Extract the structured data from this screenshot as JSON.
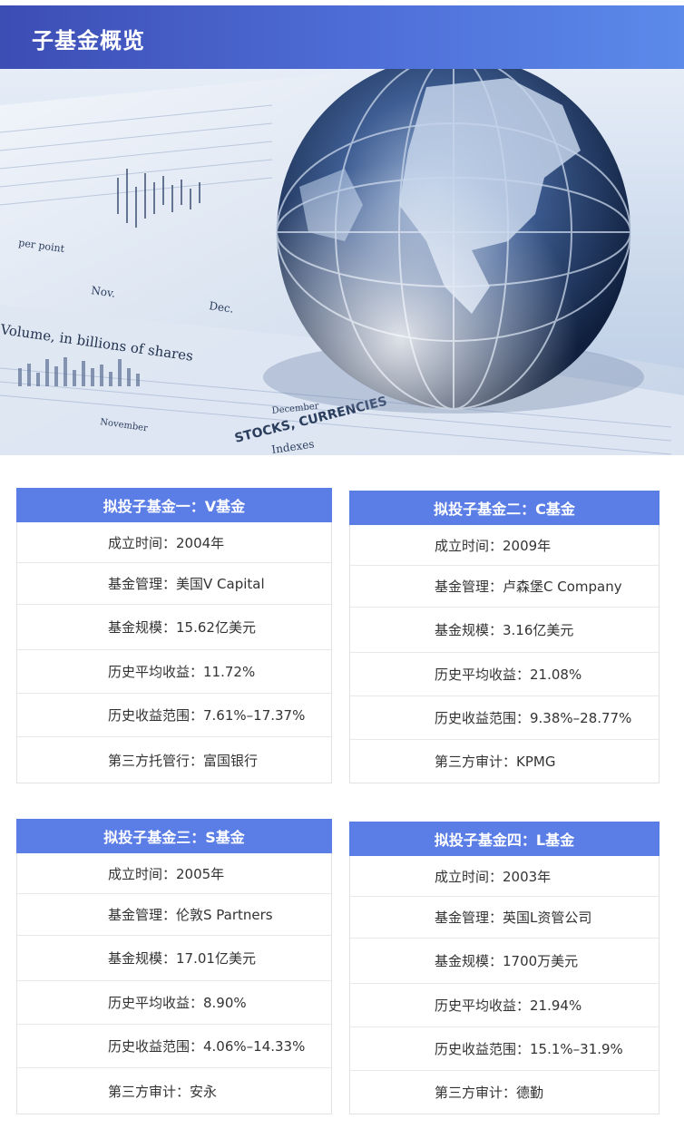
{
  "header": {
    "title": "子基金概览"
  },
  "hero": {
    "volume_text": "Volume, in billions of shares",
    "nov": "Nov.",
    "dec": "Dec.",
    "stocks_text": "STOCKS, CURRENCIES",
    "indexes_text": "Indexes",
    "november": "November",
    "december": "December",
    "point_text": "per point"
  },
  "funds": [
    {
      "title": "拟投子基金一：V基金",
      "rows": [
        "成立时间：2004年",
        "基金管理：美国V Capital",
        "基金规模：15.62亿美元",
        "历史平均收益：11.72%",
        "历史收益范围：7.61%–17.37%",
        "第三方托管行：富国银行"
      ]
    },
    {
      "title": "拟投子基金二：C基金",
      "rows": [
        "成立时间：2009年",
        "基金管理：卢森堡C Company",
        "基金规模：3.16亿美元",
        "历史平均收益：21.08%",
        "历史收益范围：9.38%–28.77%",
        "第三方审计：KPMG"
      ]
    },
    {
      "title": "拟投子基金三：S基金",
      "rows": [
        "成立时间：2005年",
        "基金管理：伦敦S Partners",
        "基金规模：17.01亿美元",
        "历史平均收益：8.90%",
        "历史收益范围：4.06%–14.33%",
        "第三方审计：安永"
      ]
    },
    {
      "title": "拟投子基金四：L基金",
      "rows": [
        "成立时间：2003年",
        "基金管理：英国L资管公司",
        "基金规模：1700万美元",
        "历史平均收益：21.94%",
        "历史收益范围：15.1%–31.9%",
        "第三方审计：德勤"
      ]
    }
  ]
}
